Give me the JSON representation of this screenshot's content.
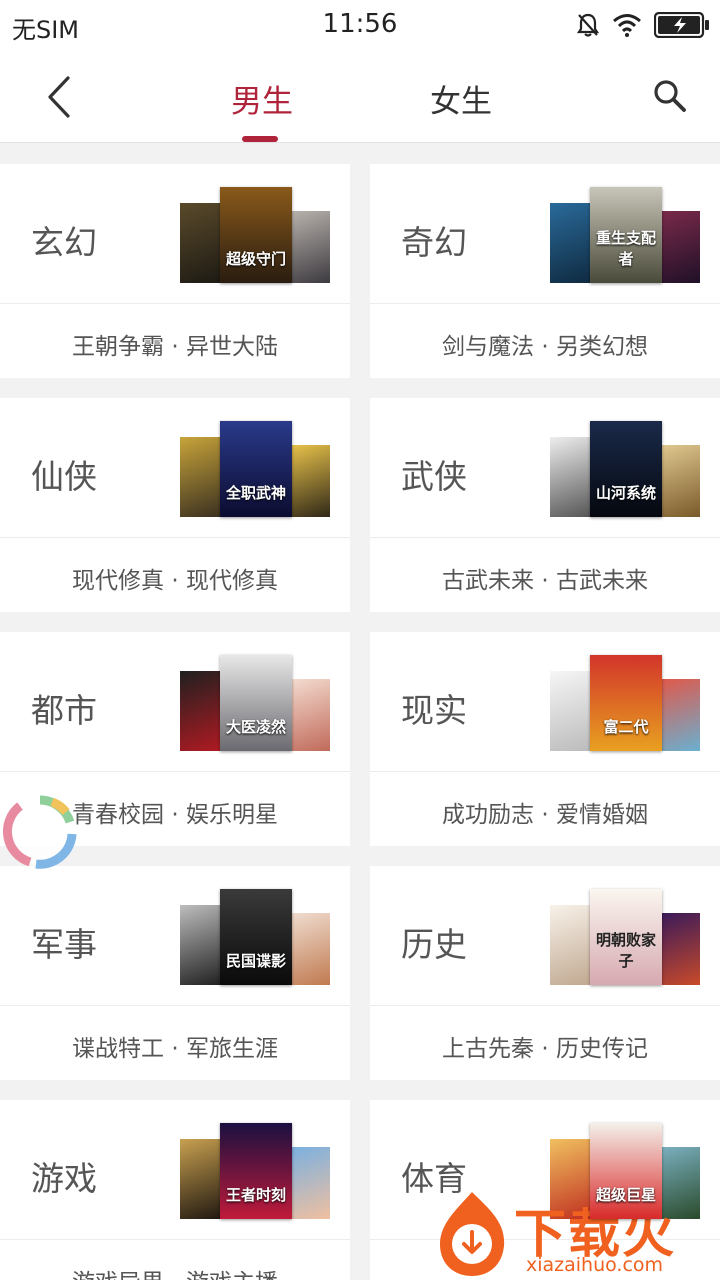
{
  "status": {
    "carrier": "无SIM",
    "time": "11:56",
    "icons": [
      "mute-icon",
      "wifi-icon",
      "battery-charging-icon"
    ]
  },
  "nav": {
    "tabs": [
      {
        "label": "男生",
        "active": true
      },
      {
        "label": "女生",
        "active": false
      }
    ],
    "accent": "#b0243b",
    "icons": [
      "back-chevron-icon",
      "search-icon"
    ]
  },
  "categories": [
    {
      "title": "玄幻",
      "sub": "王朝争霸 · 异世大陆",
      "cover_text": "超级守门"
    },
    {
      "title": "奇幻",
      "sub": "剑与魔法 · 另类幻想",
      "cover_text": "重生支配者"
    },
    {
      "title": "仙侠",
      "sub": "现代修真 · 现代修真",
      "cover_text": "全职武神"
    },
    {
      "title": "武侠",
      "sub": "古武未来 · 古武未来",
      "cover_text": "山河系统"
    },
    {
      "title": "都市",
      "sub": "青春校园 · 娱乐明星",
      "cover_text": "大医凌然"
    },
    {
      "title": "现实",
      "sub": "成功励志 · 爱情婚姻",
      "cover_text": "富二代"
    },
    {
      "title": "军事",
      "sub": "谍战特工 · 军旅生涯",
      "cover_text": "民国谍影"
    },
    {
      "title": "历史",
      "sub": "上古先秦 · 历史传记",
      "cover_text": "明朝败家子"
    },
    {
      "title": "游戏",
      "sub": "游戏异界 · 游戏主播",
      "cover_text": "王者时刻"
    },
    {
      "title": "体育",
      "sub": "",
      "cover_text": "超级巨星"
    }
  ],
  "watermark": {
    "text": "下载火",
    "url": "xiazaihuo.com"
  }
}
